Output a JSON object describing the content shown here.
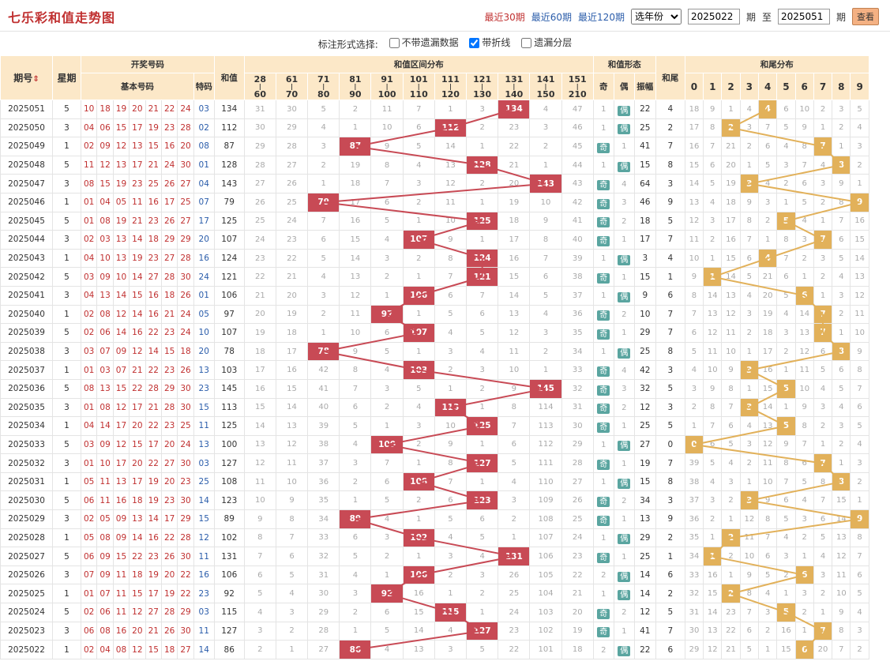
{
  "title": "七乐彩和值走势图",
  "filters": {
    "recent30": "最近30期",
    "recent60": "最近60期",
    "recent120": "最近120期",
    "year_select": "选年份",
    "from_value": "2025022",
    "from_suffix": "期",
    "to_label": "至",
    "to_value": "2025051",
    "to_suffix": "期",
    "query": "查看"
  },
  "options": {
    "label": "标注形式选择:",
    "opt1": "不带遗漏数据",
    "opt2": "带折线",
    "opt3": "遗漏分层",
    "opt1_checked": false,
    "opt2_checked": true,
    "opt3_checked": false
  },
  "headers": {
    "period": "期号",
    "weekday": "星期",
    "draw": "开奖号码",
    "basic": "基本号码",
    "special": "特码",
    "sum": "和值",
    "range": "和值区间分布",
    "shape": "和值形态",
    "odd": "奇",
    "even": "偶",
    "amp": "振幅",
    "tail": "和尾",
    "taildist": "和尾分布"
  },
  "ranges": [
    [
      "28",
      "60"
    ],
    [
      "61",
      "70"
    ],
    [
      "71",
      "80"
    ],
    [
      "81",
      "90"
    ],
    [
      "91",
      "100"
    ],
    [
      "101",
      "110"
    ],
    [
      "111",
      "120"
    ],
    [
      "121",
      "130"
    ],
    [
      "131",
      "140"
    ],
    [
      "141",
      "150"
    ],
    [
      "151",
      "210"
    ]
  ],
  "tails": [
    "0",
    "1",
    "2",
    "3",
    "4",
    "5",
    "6",
    "7",
    "8",
    "9"
  ],
  "colors": {
    "hit": "#c84a55",
    "tail": "#e2b15a",
    "line_sum": "#c84a55",
    "line_tail": "#e2b15a",
    "header": "#fce8c8"
  },
  "rows": [
    {
      "p": "2025051",
      "w": "5",
      "b": [
        "10",
        "18",
        "19",
        "20",
        "21",
        "22",
        "24"
      ],
      "s": "03",
      "sum": 134,
      "rm": [
        "31",
        "30",
        "5",
        "2",
        "11",
        "7",
        "1",
        "3",
        "",
        "4",
        "47"
      ],
      "os": "偶",
      "om": "1",
      "amp": "22",
      "tail": 4,
      "tm": [
        "18",
        "9",
        "1",
        "4",
        "",
        "6",
        "10",
        "2",
        "3",
        "5"
      ]
    },
    {
      "p": "2025050",
      "w": "3",
      "b": [
        "04",
        "06",
        "15",
        "17",
        "19",
        "23",
        "28"
      ],
      "s": "02",
      "sum": 112,
      "rm": [
        "30",
        "29",
        "4",
        "1",
        "10",
        "6",
        "",
        "2",
        "23",
        "3",
        "46"
      ],
      "os": "偶",
      "om": "1",
      "amp": "25",
      "tail": 2,
      "tm": [
        "17",
        "8",
        "",
        "3",
        "7",
        "5",
        "9",
        "1",
        "2",
        "4"
      ]
    },
    {
      "p": "2025049",
      "w": "1",
      "b": [
        "02",
        "09",
        "12",
        "13",
        "15",
        "16",
        "20"
      ],
      "s": "08",
      "sum": 87,
      "rm": [
        "29",
        "28",
        "3",
        "",
        "9",
        "5",
        "14",
        "1",
        "22",
        "2",
        "45"
      ],
      "os": "奇",
      "om": "1",
      "amp": "41",
      "tail": 7,
      "tm": [
        "16",
        "7",
        "21",
        "2",
        "6",
        "4",
        "8",
        "",
        "1",
        "3"
      ]
    },
    {
      "p": "2025048",
      "w": "5",
      "b": [
        "11",
        "12",
        "13",
        "17",
        "21",
        "24",
        "30"
      ],
      "s": "01",
      "sum": 128,
      "rm": [
        "28",
        "27",
        "2",
        "19",
        "8",
        "4",
        "13",
        "",
        "21",
        "1",
        "44"
      ],
      "os": "偶",
      "om": "1",
      "amp": "15",
      "tail": 8,
      "tm": [
        "15",
        "6",
        "20",
        "1",
        "5",
        "3",
        "7",
        "4",
        "",
        "2"
      ]
    },
    {
      "p": "2025047",
      "w": "3",
      "b": [
        "08",
        "15",
        "19",
        "23",
        "25",
        "26",
        "27"
      ],
      "s": "04",
      "sum": 143,
      "rm": [
        "27",
        "26",
        "1",
        "18",
        "7",
        "3",
        "12",
        "2",
        "20",
        "",
        "43"
      ],
      "os": "奇",
      "om": "4",
      "amp": "64",
      "tail": 3,
      "tm": [
        "14",
        "5",
        "19",
        "",
        "4",
        "2",
        "6",
        "3",
        "9",
        "1"
      ]
    },
    {
      "p": "2025046",
      "w": "1",
      "b": [
        "01",
        "04",
        "05",
        "11",
        "16",
        "17",
        "25"
      ],
      "s": "07",
      "sum": 79,
      "rm": [
        "26",
        "25",
        "",
        "17",
        "6",
        "2",
        "11",
        "1",
        "19",
        "10",
        "42"
      ],
      "os": "奇",
      "om": "3",
      "amp": "46",
      "tail": 9,
      "tm": [
        "13",
        "4",
        "18",
        "9",
        "3",
        "1",
        "5",
        "2",
        "8",
        ""
      ]
    },
    {
      "p": "2025045",
      "w": "5",
      "b": [
        "01",
        "08",
        "19",
        "21",
        "23",
        "26",
        "27"
      ],
      "s": "17",
      "sum": 125,
      "rm": [
        "25",
        "24",
        "7",
        "16",
        "5",
        "1",
        "10",
        "",
        "18",
        "9",
        "41"
      ],
      "os": "奇",
      "om": "2",
      "amp": "18",
      "tail": 5,
      "tm": [
        "12",
        "3",
        "17",
        "8",
        "2",
        "",
        "4",
        "1",
        "7",
        "16"
      ]
    },
    {
      "p": "2025044",
      "w": "3",
      "b": [
        "02",
        "03",
        "13",
        "14",
        "18",
        "29",
        "29"
      ],
      "s": "20",
      "sum": 107,
      "rm": [
        "24",
        "23",
        "6",
        "15",
        "4",
        "",
        "9",
        "1",
        "17",
        "8",
        "40"
      ],
      "os": "奇",
      "om": "1",
      "amp": "17",
      "tail": 7,
      "tm": [
        "11",
        "2",
        "16",
        "7",
        "1",
        "8",
        "3",
        "",
        "6",
        "15"
      ]
    },
    {
      "p": "2025043",
      "w": "1",
      "b": [
        "04",
        "10",
        "13",
        "19",
        "23",
        "27",
        "28"
      ],
      "s": "16",
      "sum": 124,
      "rm": [
        "23",
        "22",
        "5",
        "14",
        "3",
        "2",
        "8",
        "",
        "16",
        "7",
        "39"
      ],
      "os": "偶",
      "om": "1",
      "amp": "3",
      "tail": 4,
      "tm": [
        "10",
        "1",
        "15",
        "6",
        "",
        "7",
        "2",
        "3",
        "5",
        "14"
      ]
    },
    {
      "p": "2025042",
      "w": "5",
      "b": [
        "03",
        "09",
        "10",
        "14",
        "27",
        "28",
        "30"
      ],
      "s": "24",
      "sum": 121,
      "rm": [
        "22",
        "21",
        "4",
        "13",
        "2",
        "1",
        "7",
        "",
        "15",
        "6",
        "38"
      ],
      "os": "奇",
      "om": "1",
      "amp": "15",
      "tail": 1,
      "tm": [
        "9",
        "",
        "14",
        "5",
        "21",
        "6",
        "1",
        "2",
        "4",
        "13"
      ]
    },
    {
      "p": "2025041",
      "w": "3",
      "b": [
        "04",
        "13",
        "14",
        "15",
        "16",
        "18",
        "26"
      ],
      "s": "01",
      "sum": 106,
      "rm": [
        "21",
        "20",
        "3",
        "12",
        "1",
        "",
        "6",
        "7",
        "14",
        "5",
        "37"
      ],
      "os": "偶",
      "om": "1",
      "amp": "9",
      "tail": 6,
      "tm": [
        "8",
        "14",
        "13",
        "4",
        "20",
        "5",
        "",
        "1",
        "3",
        "12"
      ]
    },
    {
      "p": "2025040",
      "w": "1",
      "b": [
        "02",
        "08",
        "12",
        "14",
        "16",
        "21",
        "24"
      ],
      "s": "05",
      "sum": 97,
      "rm": [
        "20",
        "19",
        "2",
        "11",
        "",
        "1",
        "5",
        "6",
        "13",
        "4",
        "36"
      ],
      "os": "奇",
      "om": "2",
      "amp": "10",
      "tail": 7,
      "tm": [
        "7",
        "13",
        "12",
        "3",
        "19",
        "4",
        "14",
        "",
        "2",
        "11"
      ]
    },
    {
      "p": "2025039",
      "w": "5",
      "b": [
        "02",
        "06",
        "14",
        "16",
        "22",
        "23",
        "24"
      ],
      "s": "10",
      "sum": 107,
      "rm": [
        "19",
        "18",
        "1",
        "10",
        "6",
        "",
        "4",
        "5",
        "12",
        "3",
        "35"
      ],
      "os": "奇",
      "om": "1",
      "amp": "29",
      "tail": 7,
      "tm": [
        "6",
        "12",
        "11",
        "2",
        "18",
        "3",
        "13",
        "",
        "1",
        "10"
      ]
    },
    {
      "p": "2025038",
      "w": "3",
      "b": [
        "03",
        "07",
        "09",
        "12",
        "14",
        "15",
        "18"
      ],
      "s": "20",
      "sum": 78,
      "rm": [
        "18",
        "17",
        "",
        "9",
        "5",
        "1",
        "3",
        "4",
        "11",
        "2",
        "34"
      ],
      "os": "偶",
      "om": "1",
      "amp": "25",
      "tail": 8,
      "tm": [
        "5",
        "11",
        "10",
        "1",
        "17",
        "2",
        "12",
        "6",
        "",
        "9"
      ]
    },
    {
      "p": "2025037",
      "w": "1",
      "b": [
        "01",
        "03",
        "07",
        "21",
        "22",
        "23",
        "26"
      ],
      "s": "13",
      "sum": 103,
      "rm": [
        "17",
        "16",
        "42",
        "8",
        "4",
        "",
        "2",
        "3",
        "10",
        "1",
        "33"
      ],
      "os": "奇",
      "om": "4",
      "amp": "42",
      "tail": 3,
      "tm": [
        "4",
        "10",
        "9",
        "",
        "16",
        "1",
        "11",
        "5",
        "6",
        "8"
      ]
    },
    {
      "p": "2025036",
      "w": "5",
      "b": [
        "08",
        "13",
        "15",
        "22",
        "28",
        "29",
        "30"
      ],
      "s": "23",
      "sum": 145,
      "rm": [
        "16",
        "15",
        "41",
        "7",
        "3",
        "5",
        "1",
        "2",
        "9",
        "",
        "32"
      ],
      "os": "奇",
      "om": "3",
      "amp": "32",
      "tail": 5,
      "tm": [
        "3",
        "9",
        "8",
        "1",
        "15",
        "",
        "10",
        "4",
        "5",
        "7"
      ]
    },
    {
      "p": "2025035",
      "w": "3",
      "b": [
        "01",
        "08",
        "12",
        "17",
        "21",
        "28",
        "30"
      ],
      "s": "15",
      "sum": 113,
      "rm": [
        "15",
        "14",
        "40",
        "6",
        "2",
        "4",
        "",
        "1",
        "8",
        "114",
        "31"
      ],
      "os": "奇",
      "om": "2",
      "amp": "12",
      "tail": 3,
      "tm": [
        "2",
        "8",
        "7",
        "",
        "14",
        "1",
        "9",
        "3",
        "4",
        "6"
      ]
    },
    {
      "p": "2025034",
      "w": "1",
      "b": [
        "04",
        "14",
        "17",
        "20",
        "22",
        "23",
        "25"
      ],
      "s": "11",
      "sum": 125,
      "rm": [
        "14",
        "13",
        "39",
        "5",
        "1",
        "3",
        "10",
        "",
        "7",
        "113",
        "30"
      ],
      "os": "奇",
      "om": "1",
      "amp": "25",
      "tail": 5,
      "tm": [
        "1",
        "7",
        "6",
        "4",
        "13",
        "",
        "8",
        "2",
        "3",
        "5"
      ]
    },
    {
      "p": "2025033",
      "w": "5",
      "b": [
        "03",
        "09",
        "12",
        "15",
        "17",
        "20",
        "24"
      ],
      "s": "13",
      "sum": 100,
      "rm": [
        "13",
        "12",
        "38",
        "4",
        "",
        "2",
        "9",
        "1",
        "6",
        "112",
        "29"
      ],
      "os": "偶",
      "om": "1",
      "amp": "27",
      "tail": 0,
      "tm": [
        "",
        "6",
        "5",
        "3",
        "12",
        "9",
        "7",
        "1",
        "2",
        "4"
      ]
    },
    {
      "p": "2025032",
      "w": "3",
      "b": [
        "01",
        "10",
        "17",
        "20",
        "22",
        "27",
        "30"
      ],
      "s": "03",
      "sum": 127,
      "rm": [
        "12",
        "11",
        "37",
        "3",
        "7",
        "1",
        "8",
        "",
        "5",
        "111",
        "28"
      ],
      "os": "奇",
      "om": "1",
      "amp": "19",
      "tail": 7,
      "tm": [
        "39",
        "5",
        "4",
        "2",
        "11",
        "8",
        "6",
        "",
        "1",
        "3"
      ]
    },
    {
      "p": "2025031",
      "w": "1",
      "b": [
        "05",
        "11",
        "13",
        "17",
        "19",
        "20",
        "23"
      ],
      "s": "25",
      "sum": 108,
      "rm": [
        "11",
        "10",
        "36",
        "2",
        "6",
        "",
        "7",
        "1",
        "4",
        "110",
        "27"
      ],
      "os": "偶",
      "om": "1",
      "amp": "15",
      "tail": 8,
      "tm": [
        "38",
        "4",
        "3",
        "1",
        "10",
        "7",
        "5",
        "8",
        "",
        "2"
      ]
    },
    {
      "p": "2025030",
      "w": "5",
      "b": [
        "06",
        "11",
        "16",
        "18",
        "19",
        "23",
        "30"
      ],
      "s": "14",
      "sum": 123,
      "rm": [
        "10",
        "9",
        "35",
        "1",
        "5",
        "2",
        "6",
        "",
        "3",
        "109",
        "26"
      ],
      "os": "奇",
      "om": "2",
      "amp": "34",
      "tail": 3,
      "tm": [
        "37",
        "3",
        "2",
        "",
        "9",
        "6",
        "4",
        "7",
        "15",
        "1"
      ]
    },
    {
      "p": "2025029",
      "w": "3",
      "b": [
        "02",
        "05",
        "09",
        "13",
        "14",
        "17",
        "29"
      ],
      "s": "15",
      "sum": 89,
      "rm": [
        "9",
        "8",
        "34",
        "",
        "4",
        "1",
        "5",
        "6",
        "2",
        "108",
        "25"
      ],
      "os": "奇",
      "om": "1",
      "amp": "13",
      "tail": 9,
      "tm": [
        "36",
        "2",
        "1",
        "12",
        "8",
        "5",
        "3",
        "6",
        "14",
        ""
      ]
    },
    {
      "p": "2025028",
      "w": "1",
      "b": [
        "05",
        "08",
        "09",
        "14",
        "16",
        "22",
        "28"
      ],
      "s": "12",
      "sum": 102,
      "rm": [
        "8",
        "7",
        "33",
        "6",
        "3",
        "",
        "4",
        "5",
        "1",
        "107",
        "24"
      ],
      "os": "偶",
      "om": "1",
      "amp": "29",
      "tail": 2,
      "tm": [
        "35",
        "1",
        "",
        "11",
        "7",
        "4",
        "2",
        "5",
        "13",
        "8"
      ]
    },
    {
      "p": "2025027",
      "w": "5",
      "b": [
        "06",
        "09",
        "15",
        "22",
        "23",
        "26",
        "30"
      ],
      "s": "11",
      "sum": 131,
      "rm": [
        "7",
        "6",
        "32",
        "5",
        "2",
        "1",
        "3",
        "4",
        "",
        "106",
        "23"
      ],
      "os": "奇",
      "om": "1",
      "amp": "25",
      "tail": 1,
      "tm": [
        "34",
        "",
        "2",
        "10",
        "6",
        "3",
        "1",
        "4",
        "12",
        "7"
      ]
    },
    {
      "p": "2025026",
      "w": "3",
      "b": [
        "07",
        "09",
        "11",
        "18",
        "19",
        "20",
        "22"
      ],
      "s": "16",
      "sum": 106,
      "rm": [
        "6",
        "5",
        "31",
        "4",
        "1",
        "",
        "2",
        "3",
        "26",
        "105",
        "22"
      ],
      "os": "偶",
      "om": "2",
      "amp": "14",
      "tail": 6,
      "tm": [
        "33",
        "16",
        "1",
        "9",
        "5",
        "2",
        "",
        "3",
        "11",
        "6"
      ]
    },
    {
      "p": "2025025",
      "w": "1",
      "b": [
        "01",
        "07",
        "11",
        "15",
        "17",
        "19",
        "22"
      ],
      "s": "23",
      "sum": 92,
      "rm": [
        "5",
        "4",
        "30",
        "3",
        "",
        "16",
        "1",
        "2",
        "25",
        "104",
        "21"
      ],
      "os": "偶",
      "om": "1",
      "amp": "14",
      "tail": 2,
      "tm": [
        "32",
        "15",
        "",
        "8",
        "4",
        "1",
        "3",
        "2",
        "10",
        "5"
      ]
    },
    {
      "p": "2025024",
      "w": "5",
      "b": [
        "02",
        "06",
        "11",
        "12",
        "27",
        "28",
        "29"
      ],
      "s": "03",
      "sum": 115,
      "rm": [
        "4",
        "3",
        "29",
        "2",
        "6",
        "15",
        "",
        "1",
        "24",
        "103",
        "20"
      ],
      "os": "奇",
      "om": "2",
      "amp": "12",
      "tail": 5,
      "tm": [
        "31",
        "14",
        "23",
        "7",
        "3",
        "",
        "2",
        "1",
        "9",
        "4"
      ]
    },
    {
      "p": "2025023",
      "w": "3",
      "b": [
        "06",
        "08",
        "16",
        "20",
        "21",
        "26",
        "30"
      ],
      "s": "11",
      "sum": 127,
      "rm": [
        "3",
        "2",
        "28",
        "1",
        "5",
        "14",
        "4",
        "",
        "23",
        "102",
        "19"
      ],
      "os": "奇",
      "om": "1",
      "amp": "41",
      "tail": 7,
      "tm": [
        "30",
        "13",
        "22",
        "6",
        "2",
        "16",
        "1",
        "",
        "8",
        "3"
      ]
    },
    {
      "p": "2025022",
      "w": "1",
      "b": [
        "02",
        "04",
        "08",
        "12",
        "15",
        "18",
        "27"
      ],
      "s": "14",
      "sum": 86,
      "rm": [
        "2",
        "1",
        "27",
        "",
        "4",
        "13",
        "3",
        "5",
        "22",
        "101",
        "18"
      ],
      "os": "偶",
      "om": "2",
      "amp": "22",
      "tail": 6,
      "tm": [
        "29",
        "12",
        "21",
        "5",
        "1",
        "15",
        "",
        "20",
        "7",
        "2"
      ]
    }
  ]
}
